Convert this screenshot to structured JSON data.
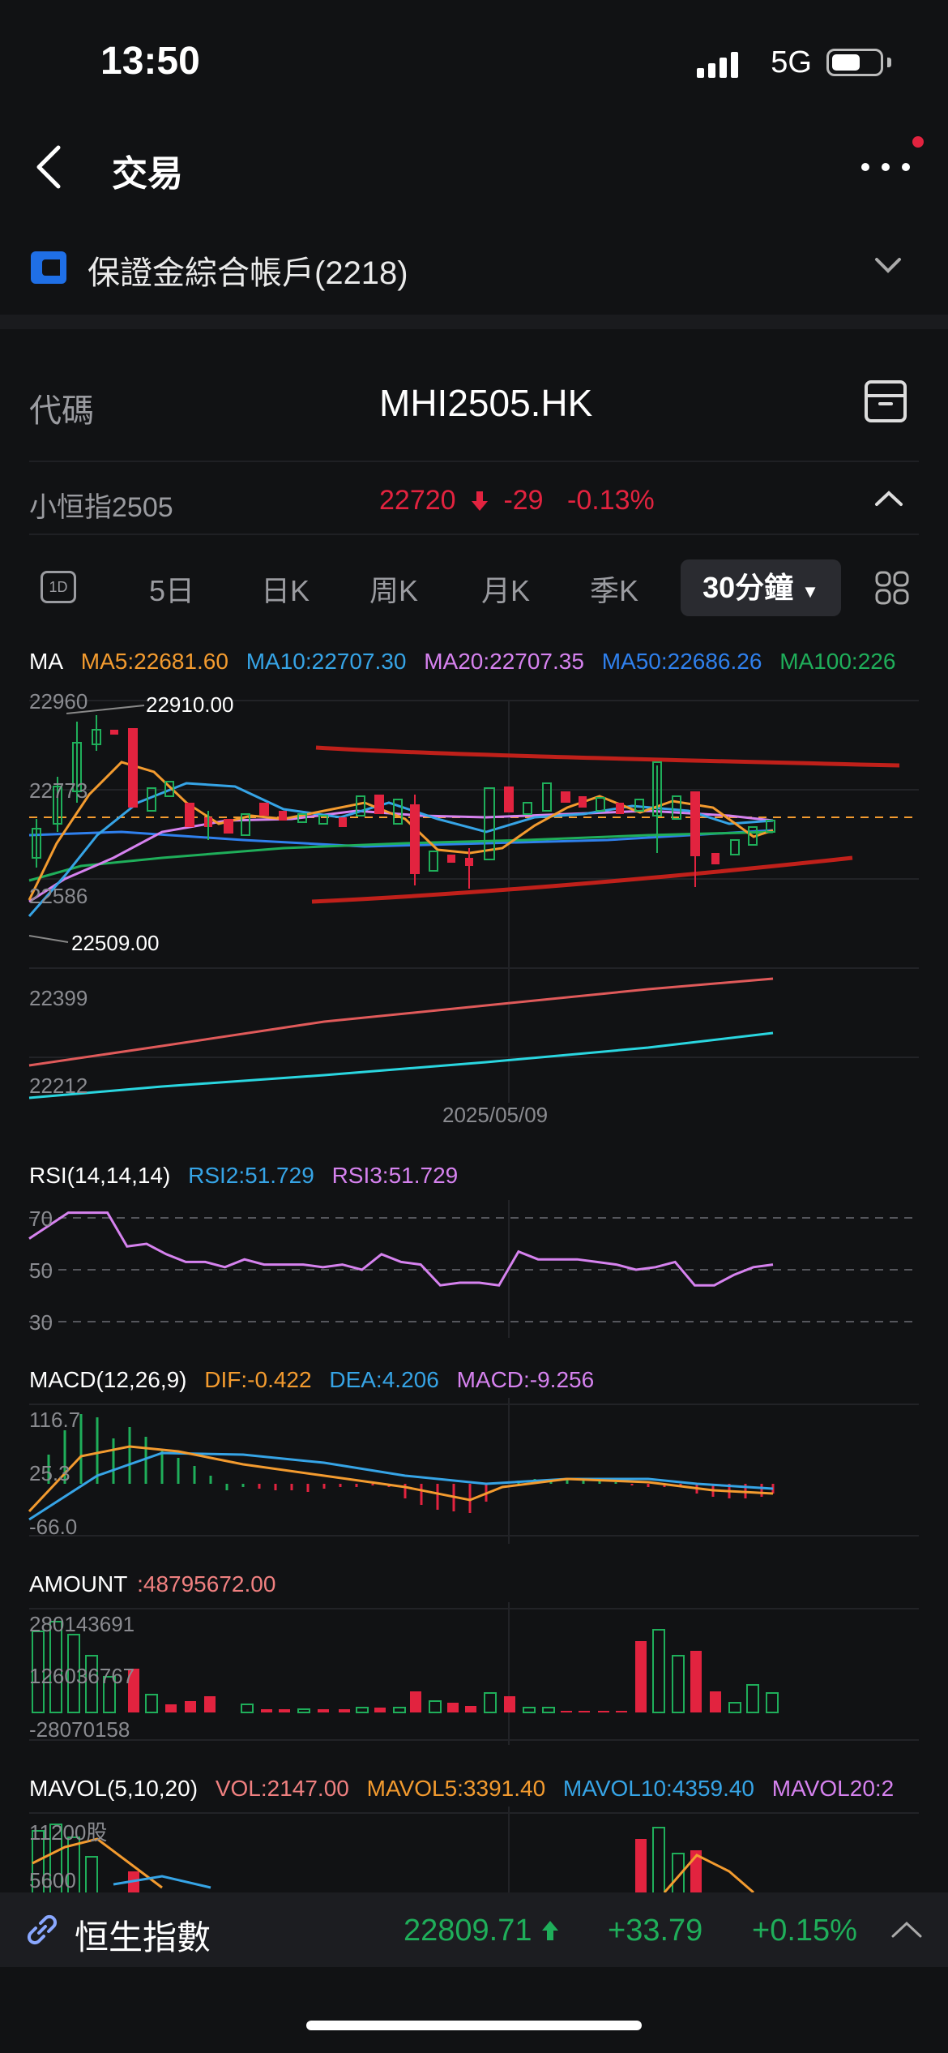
{
  "status": {
    "time": "13:50",
    "network": "5G"
  },
  "nav": {
    "title": "交易"
  },
  "account": {
    "name": "保證金綜合帳戶(2218)"
  },
  "quote": {
    "code_label": "代碼",
    "code": "MHI2505.HK",
    "name": "小恒指2505",
    "price": "22720",
    "change": "-29",
    "change_pct": "-0.13%"
  },
  "tabs": [
    "5日",
    "日K",
    "周K",
    "月K",
    "季K"
  ],
  "tab_1d": "1D",
  "tab_active": "30分鐘",
  "ma": {
    "label": "MA",
    "ma5": "MA5:22681.60",
    "ma10": "MA10:22707.30",
    "ma20": "MA20:22707.35",
    "ma50": "MA50:22686.26",
    "ma100": "MA100:226"
  },
  "colors": {
    "red": "#e2233f",
    "green": "#1fae5a",
    "orange": "#f39b2f",
    "blue": "#36a4e6",
    "pink": "#d682ef",
    "cyan": "#2ad6e0"
  },
  "chart_data": [
    {
      "type": "candlestick",
      "y_ticks": [
        "22960",
        "22773",
        "22586",
        "22399",
        "22212"
      ],
      "high_marker": "22910.00",
      "low_marker": "22509.00",
      "x_label": "2025/05/09",
      "last_price_line": 22720
    },
    {
      "type": "line",
      "title": "RSI(14,14,14)",
      "legend": [
        "RSI2:51.729",
        "RSI3:51.729"
      ],
      "y_ticks": [
        "70",
        "50",
        "30"
      ],
      "ylim": [
        20,
        80
      ],
      "values": [
        62,
        67,
        72,
        72,
        72,
        59,
        60,
        56,
        53,
        53,
        51,
        54,
        52,
        52,
        52,
        51,
        52,
        50,
        56,
        53,
        52,
        44,
        45,
        45,
        44,
        57,
        54,
        54,
        54,
        53,
        52,
        50,
        51,
        53,
        44,
        44,
        48,
        51,
        52
      ]
    },
    {
      "type": "bar",
      "title": "MACD(12,26,9)",
      "legend": [
        "DIF:-0.422",
        "DEA:4.206",
        "MACD:-9.256"
      ],
      "y_ticks": [
        "116.7",
        "25.3",
        "-66.0"
      ]
    },
    {
      "type": "bar",
      "title": "AMOUNT",
      "legend": [
        ":48795672.00"
      ],
      "y_ticks": [
        "280143691",
        "126036767",
        "-28070158"
      ]
    },
    {
      "type": "bar",
      "title": "MAVOL(5,10,20)",
      "legend": [
        "VOL:2147.00",
        "MAVOL5:3391.40",
        "MAVOL10:4359.40",
        "MAVOL20:2"
      ],
      "y_ticks": [
        "11200股",
        "5600"
      ]
    }
  ],
  "index_bar": {
    "name": "恒生指數",
    "value": "22809.71",
    "change": "+33.79",
    "change_pct": "+0.15%"
  }
}
